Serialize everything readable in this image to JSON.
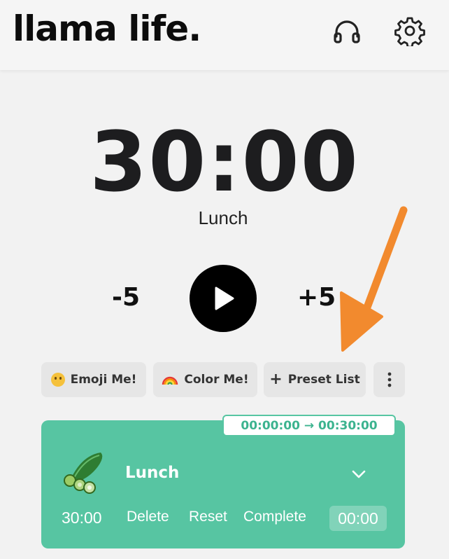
{
  "header": {
    "brand": "llama life.",
    "headphones_icon": "headphones-icon",
    "settings_icon": "gear-icon"
  },
  "timer": {
    "display": "30:00",
    "label": "Lunch",
    "minus_label": "-5",
    "plus_label": "+5",
    "play_icon": "play-icon"
  },
  "actions": {
    "emoji_label": "Emoji Me!",
    "color_label": "Color Me!",
    "preset_label": "Preset List",
    "more_icon": "vertical-dots-icon"
  },
  "task": {
    "time_range": "00:00:00 → 00:30:00",
    "title": "Lunch",
    "duration": "30:00",
    "delete_label": "Delete",
    "reset_label": "Reset",
    "complete_label": "Complete",
    "elapsed": "00:00",
    "icon": "cucumber-icon"
  },
  "colors": {
    "accent": "#57c5a2",
    "annotation_arrow": "#f28a2e",
    "background": "#f2f2f2"
  }
}
